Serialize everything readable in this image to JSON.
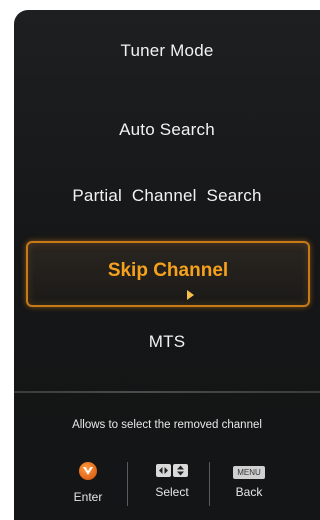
{
  "menu": {
    "items": [
      {
        "label": "Tuner Mode"
      },
      {
        "label": "Auto Search"
      },
      {
        "label": "Partial   Channel Search"
      },
      {
        "label": "Skip Channel"
      },
      {
        "label": "MTS"
      }
    ],
    "selected_index": 3
  },
  "help": {
    "text": "Allows to select the removed channel"
  },
  "footer": {
    "enter": {
      "icon": "v-logo-button-icon",
      "label": "Enter"
    },
    "select": {
      "icon": "left-right-up-down-arrows-icon",
      "label": "Select"
    },
    "back": {
      "key": "MENU",
      "label": "Back"
    }
  },
  "colors": {
    "panel_bg": "#151617",
    "text": "#f2f2f2",
    "accent": "#f5a11c",
    "highlight_border": "#c77a16"
  }
}
